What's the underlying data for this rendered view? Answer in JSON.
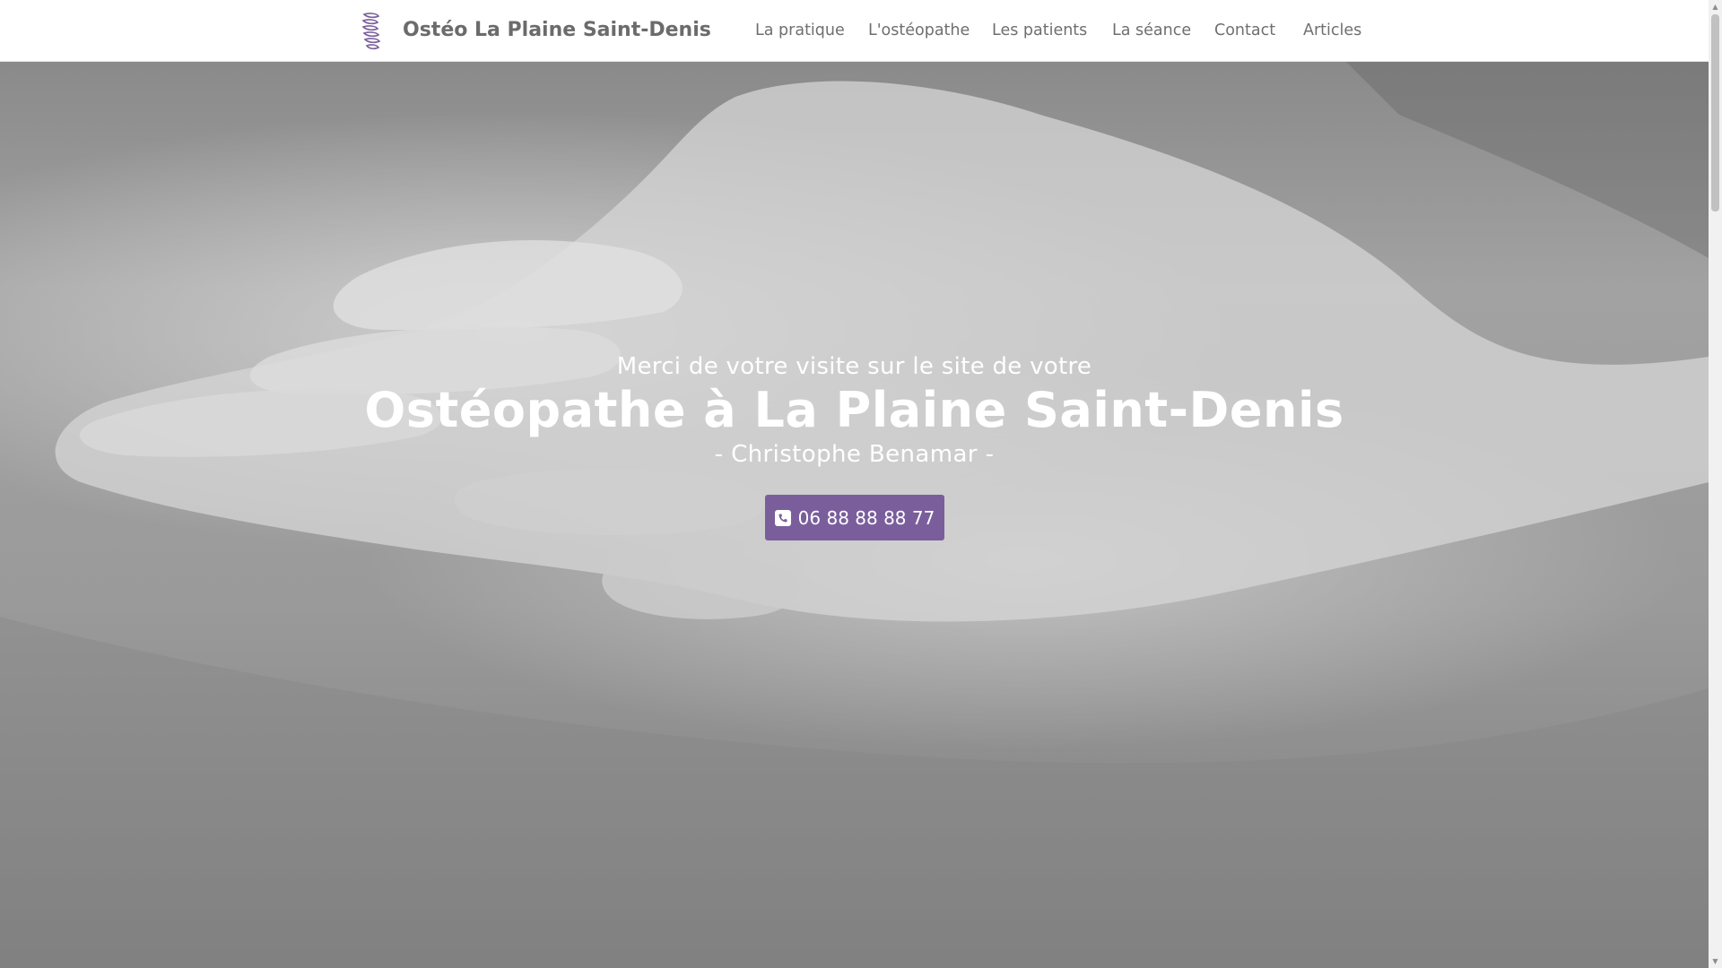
{
  "header": {
    "logo_icon": "spine-icon",
    "brand": "Ostéo La Plaine Saint-Denis",
    "nav": [
      {
        "label": "La pratique"
      },
      {
        "label": "L'ostéopathe"
      },
      {
        "label": "Les patients"
      },
      {
        "label": "La séance"
      },
      {
        "label": "Contact"
      },
      {
        "label": "Articles"
      }
    ]
  },
  "hero": {
    "lead": "Merci de votre visite sur le site de votre",
    "title": "Ostéopathe à La Plaine Saint-Denis",
    "subtitle": "- Christophe Benamar -",
    "cta": {
      "icon": "phone-icon",
      "label": "06 88 88 88 77"
    },
    "background_image": "hands-on-back-photo"
  },
  "colors": {
    "accent": "#7a5e9c",
    "nav_text": "#6f6f6f",
    "hero_text": "#ffffff"
  }
}
